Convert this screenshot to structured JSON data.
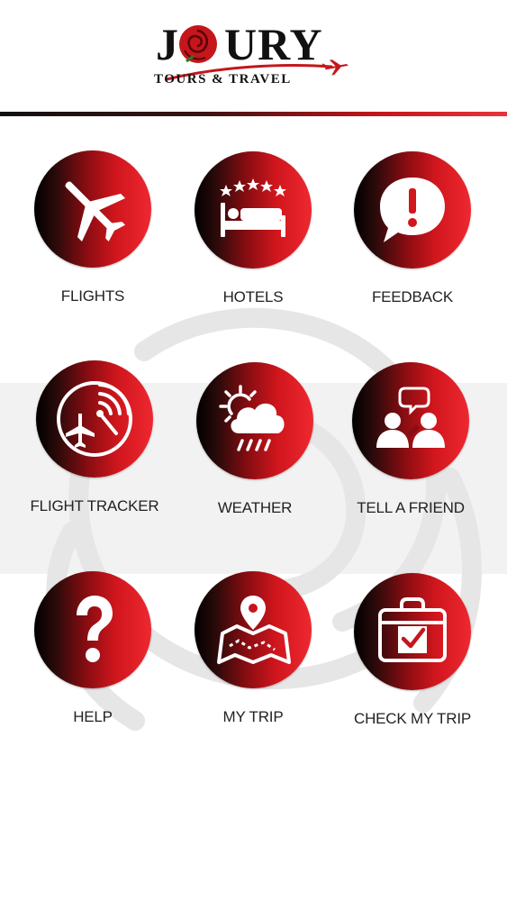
{
  "header": {
    "logo_text": "JOURY",
    "logo_subtitle": "TOURS & TRAVEL"
  },
  "colors": {
    "accent": "#d1161d",
    "dark": "#000000",
    "text": "#222222"
  },
  "tiles": [
    {
      "label": "FLIGHTS",
      "icon": "airplane-icon"
    },
    {
      "label": "HOTELS",
      "icon": "hotel-bed-icon"
    },
    {
      "label": "FEEDBACK",
      "icon": "feedback-bubble-icon"
    },
    {
      "label": "FLIGHT TRACKER",
      "icon": "flight-tracker-icon"
    },
    {
      "label": "WEATHER",
      "icon": "weather-icon"
    },
    {
      "label": "TELL A FRIEND",
      "icon": "tell-a-friend-icon"
    },
    {
      "label": "HELP",
      "icon": "question-mark-icon"
    },
    {
      "label": "MY TRIP",
      "icon": "map-pin-icon"
    },
    {
      "label": "CHECK MY TRIP",
      "icon": "briefcase-check-icon"
    }
  ]
}
